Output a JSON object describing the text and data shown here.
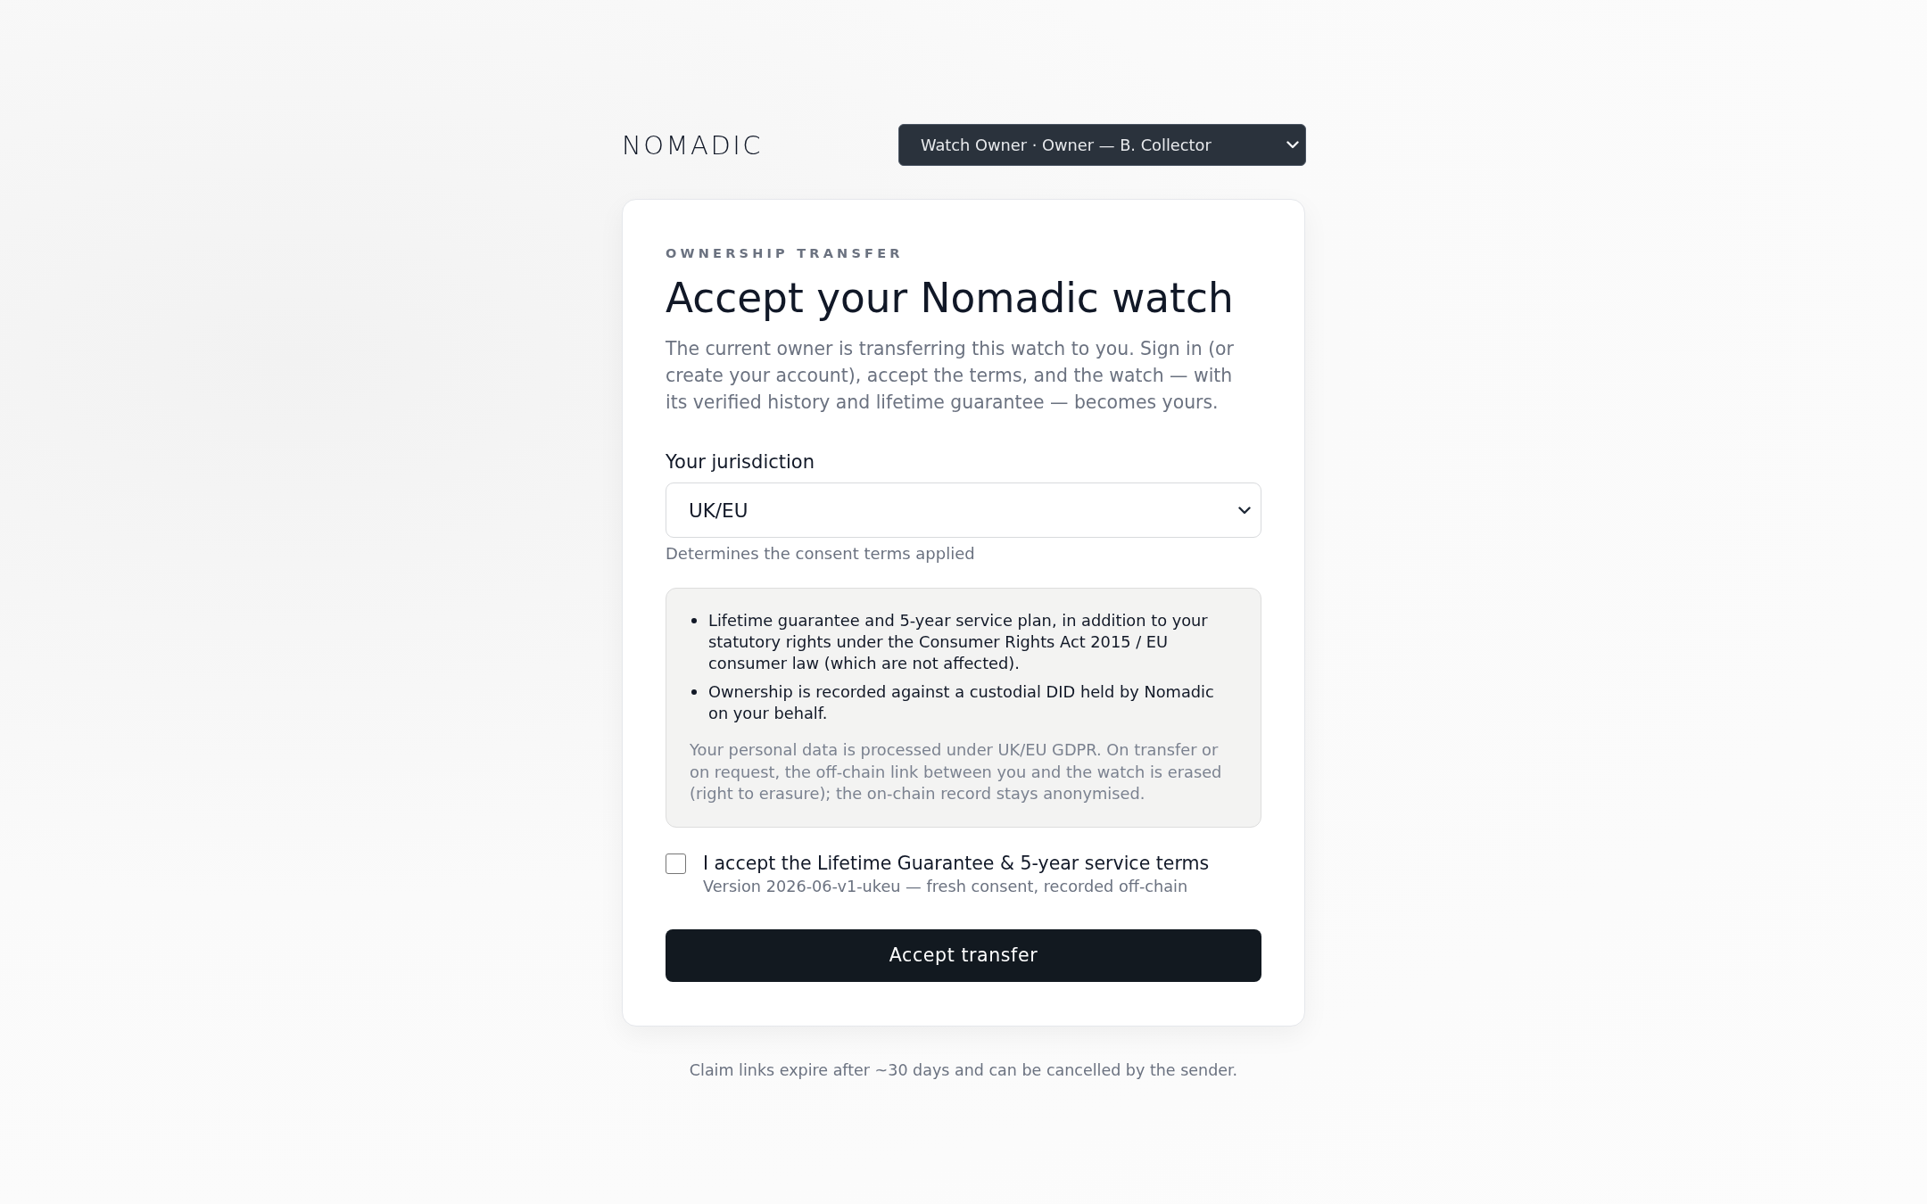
{
  "header": {
    "logo": "NOMADIC",
    "role_select": {
      "value": "Watch Owner · Owner — B. Collector"
    }
  },
  "card": {
    "eyebrow": "OWNERSHIP TRANSFER",
    "title": "Accept your Nomadic watch",
    "intro": "The current owner is transferring this watch to you. Sign in (or create your account), accept the terms, and the watch — with its verified history and lifetime guarantee — becomes yours.",
    "jurisdiction": {
      "label": "Your jurisdiction",
      "value": "UK/EU",
      "hint": "Determines the consent terms applied"
    },
    "terms_box": {
      "bullets": [
        "Lifetime guarantee and 5-year service plan, in addition to your statutory rights under the Consumer Rights Act 2015 / EU consumer law (which are not affected).",
        "Ownership is recorded against a custodial DID held by Nomadic on your behalf."
      ],
      "note": "Your personal data is processed under UK/EU GDPR. On transfer or on request, the off-chain link between you and the watch is erased (right to erasure); the on-chain record stays anonymised."
    },
    "consent": {
      "label": "I accept the Lifetime Guarantee & 5-year service terms",
      "version": "Version 2026-06-v1-ukeu — fresh consent, recorded off-chain",
      "checked": false
    },
    "accept_button": "Accept transfer"
  },
  "footer_note": "Claim links expire after ~30 days and can be cancelled by the sender."
}
